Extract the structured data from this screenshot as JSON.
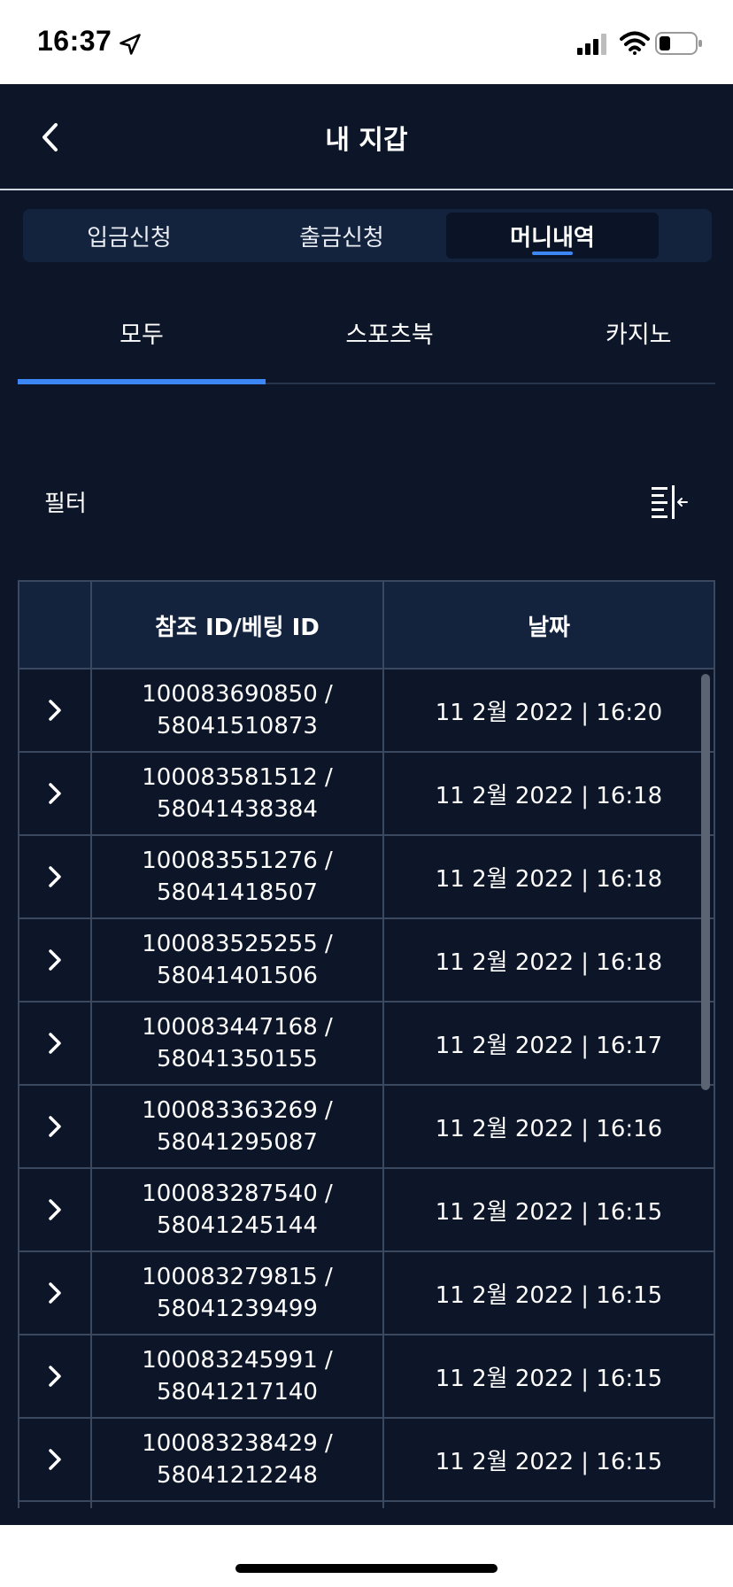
{
  "status_bar": {
    "time": "16:37"
  },
  "header": {
    "title": "내 지갑"
  },
  "wallet_tabs": [
    {
      "label": "입금신청",
      "active": false
    },
    {
      "label": "출금신청",
      "active": false
    },
    {
      "label": "머니내역",
      "active": true
    }
  ],
  "category_tabs": [
    {
      "label": "모두",
      "active": true
    },
    {
      "label": "스포츠북",
      "active": false
    },
    {
      "label": "카지노",
      "active": false
    }
  ],
  "filter": {
    "label": "필터"
  },
  "table": {
    "columns": [
      "",
      "참조 ID/베팅 ID",
      "날짜"
    ],
    "rows": [
      {
        "ref_id": "100083690850 /",
        "bet_id": "58041510873",
        "date": "11 2월 2022 | 16:20"
      },
      {
        "ref_id": "100083581512 /",
        "bet_id": "58041438384",
        "date": "11 2월 2022 | 16:18"
      },
      {
        "ref_id": "100083551276 /",
        "bet_id": "58041418507",
        "date": "11 2월 2022 | 16:18"
      },
      {
        "ref_id": "100083525255 /",
        "bet_id": "58041401506",
        "date": "11 2월 2022 | 16:18"
      },
      {
        "ref_id": "100083447168 /",
        "bet_id": "58041350155",
        "date": "11 2월 2022 | 16:17"
      },
      {
        "ref_id": "100083363269 /",
        "bet_id": "58041295087",
        "date": "11 2월 2022 | 16:16"
      },
      {
        "ref_id": "100083287540 /",
        "bet_id": "58041245144",
        "date": "11 2월 2022 | 16:15"
      },
      {
        "ref_id": "100083279815 /",
        "bet_id": "58041239499",
        "date": "11 2월 2022 | 16:15"
      },
      {
        "ref_id": "100083245991 /",
        "bet_id": "58041217140",
        "date": "11 2월 2022 | 16:15"
      },
      {
        "ref_id": "100083238429 /",
        "bet_id": "58041212248",
        "date": "11 2월 2022 | 16:15"
      }
    ]
  },
  "colors": {
    "background": "#0c1628",
    "panel": "#13233d",
    "accent": "#3d86f5",
    "border": "#3a4860"
  }
}
